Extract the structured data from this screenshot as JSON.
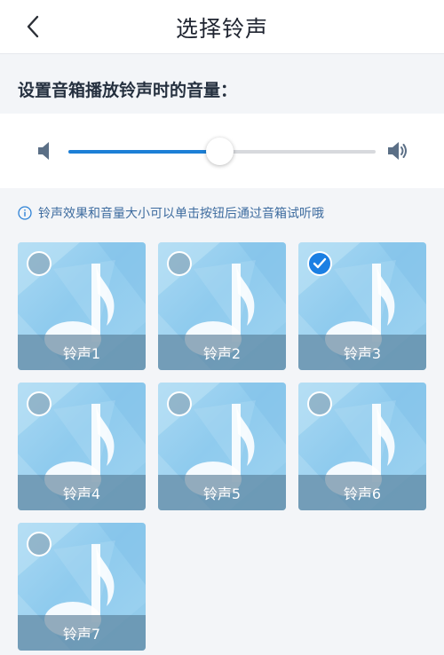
{
  "header": {
    "title": "选择铃声",
    "back_icon": "chevron-left-icon"
  },
  "volume": {
    "label": "设置音箱播放铃声时的音量：",
    "level_percent": 49,
    "min_icon": "speaker-low-icon",
    "max_icon": "speaker-high-icon",
    "accent_color": "#1c7fd6"
  },
  "notice": {
    "icon": "info-icon",
    "text": "铃声效果和音量大小可以单击按钮后通过音箱试听哦"
  },
  "ringtones": [
    {
      "name": "铃声1",
      "selected": false
    },
    {
      "name": "铃声2",
      "selected": false
    },
    {
      "name": "铃声3",
      "selected": true
    },
    {
      "name": "铃声4",
      "selected": false
    },
    {
      "name": "铃声5",
      "selected": false
    },
    {
      "name": "铃声6",
      "selected": false
    },
    {
      "name": "铃声7",
      "selected": false
    }
  ]
}
